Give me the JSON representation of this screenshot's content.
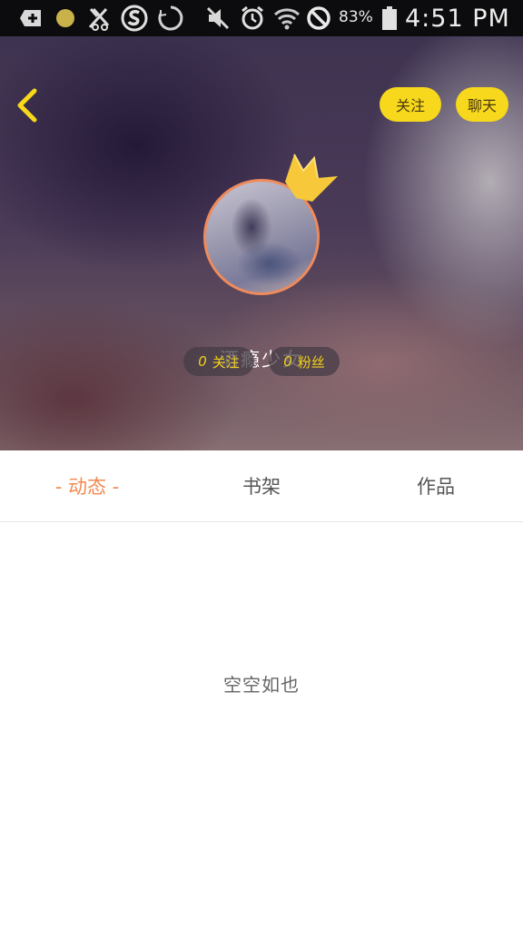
{
  "status_bar": {
    "battery_percent": "83%",
    "time": "4:51 PM",
    "icons": [
      "add-box-icon",
      "notification-dot-icon",
      "cutlery-icon",
      "sogou-icon",
      "sync-icon",
      "mute-icon",
      "alarm-icon",
      "wifi-icon",
      "no-sim-icon",
      "battery-icon"
    ]
  },
  "header": {
    "follow_label": "关注",
    "chat_label": "聊天",
    "username": "酒瘾少女",
    "following_count": "0",
    "following_label": "关注",
    "fans_count": "0",
    "fans_label": "粉丝"
  },
  "tabs": [
    {
      "label": "- 动态 -",
      "active": true
    },
    {
      "label": "书架",
      "active": false
    },
    {
      "label": "作品",
      "active": false
    }
  ],
  "empty_state": "空空如也",
  "colors": {
    "accent_yellow": "#f7d81c",
    "active_tab": "#f2894f",
    "avatar_border": "#ef8a5c"
  }
}
